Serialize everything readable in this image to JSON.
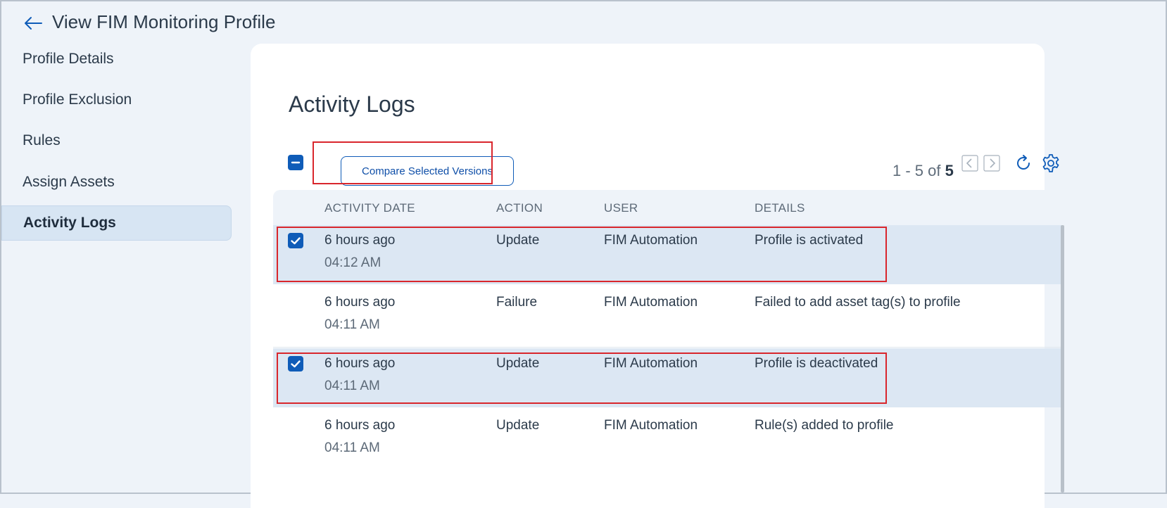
{
  "header": {
    "title": "View FIM Monitoring Profile"
  },
  "sidebar": {
    "items": [
      {
        "label": "Profile Details"
      },
      {
        "label": "Profile Exclusion"
      },
      {
        "label": "Rules"
      },
      {
        "label": "Assign Assets"
      },
      {
        "label": "Activity Logs",
        "active": true
      }
    ]
  },
  "main": {
    "title": "Activity Logs",
    "toolbar": {
      "compare_label": "Compare Selected Versions",
      "pager": {
        "range": "1 - 5 of",
        "total": "5"
      }
    },
    "table": {
      "columns": [
        "ACTIVITY DATE",
        "ACTION",
        "USER",
        "DETAILS"
      ],
      "rows": [
        {
          "date": "6 hours ago",
          "time": "04:12 AM",
          "action": "Update",
          "user": "FIM Automation",
          "details": "Profile is activated",
          "selected": true
        },
        {
          "date": "6 hours ago",
          "time": "04:11 AM",
          "action": "Failure",
          "user": "FIM Automation",
          "details": "Failed to add asset tag(s) to profile",
          "selected": false
        },
        {
          "date": "6 hours ago",
          "time": "04:11 AM",
          "action": "Update",
          "user": "FIM Automation",
          "details": "Profile is deactivated",
          "selected": true
        },
        {
          "date": "6 hours ago",
          "time": "04:11 AM",
          "action": "Update",
          "user": "FIM Automation",
          "details": "Rule(s) added to profile",
          "selected": false
        }
      ]
    }
  },
  "colors": {
    "accent": "#0f5cb8",
    "highlight": "#d9262c",
    "selected_row": "#dce7f3",
    "background": "#eef3f9"
  }
}
